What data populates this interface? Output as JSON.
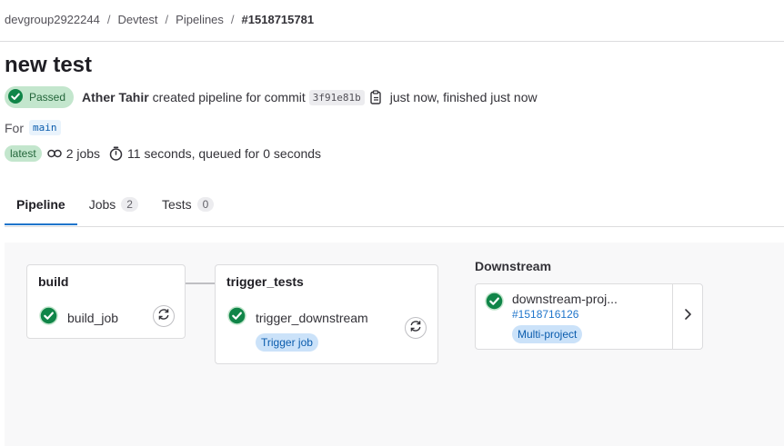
{
  "breadcrumb": {
    "items": [
      "devgroup2922244",
      "Devtest",
      "Pipelines"
    ],
    "current": "#1518715781",
    "separator": "/"
  },
  "pipeline": {
    "title": "new test",
    "status": "Passed",
    "author": "Ather Tahir",
    "created_text": "created pipeline for commit",
    "commit": "3f91e81b",
    "finished_text": "just now, finished just now",
    "for_label": "For",
    "branch": "main",
    "latest_badge": "latest",
    "jobs_text": "2 jobs",
    "duration_text": "11 seconds, queued for 0 seconds"
  },
  "tabs": [
    {
      "label": "Pipeline",
      "count": ""
    },
    {
      "label": "Jobs",
      "count": "2"
    },
    {
      "label": "Tests",
      "count": "0"
    }
  ],
  "graph": {
    "stages": [
      {
        "name": "build",
        "job": "build_job",
        "status": "success"
      },
      {
        "name": "trigger_tests",
        "job": "trigger_downstream",
        "status": "success",
        "chip": "Trigger job"
      }
    ],
    "downstream": {
      "label": "Downstream",
      "name": "downstream-proj...",
      "id": "#1518716126",
      "type": "Multi-project",
      "status": "success"
    }
  },
  "colors": {
    "success": "#108548",
    "success_bg": "#c3e6cd",
    "link": "#1f75cb",
    "chip_bg": "#cbe2f9"
  },
  "icons": {
    "status": "status-success-icon",
    "copy": "copy-to-clipboard-icon",
    "jobs": "pipeline-jobs-icon",
    "timer": "timer-icon",
    "retry": "retry-icon",
    "expand": "chevron-right-icon"
  }
}
